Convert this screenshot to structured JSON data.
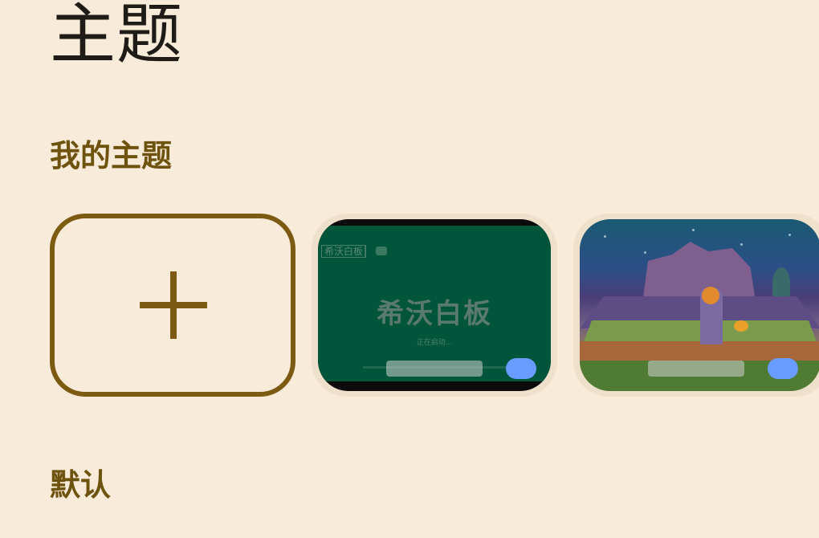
{
  "page": {
    "title": "主题"
  },
  "sections": {
    "my_themes": "我的主题",
    "default": "默认"
  },
  "add_tile": {
    "icon": "plus-icon"
  },
  "themes": [
    {
      "thumbnail": {
        "logo_text": "希沃白板",
        "title_text": "希沃白板",
        "loading_text": "正在启动..."
      },
      "toggle_on": true
    },
    {
      "thumbnail": {
        "scene": "game-scene"
      },
      "toggle_on": true
    }
  ],
  "colors": {
    "background": "#f9ebda",
    "title": "#1f1b16",
    "section_title": "#6e530f",
    "add_border": "#7d5a12",
    "tile_frame": "#efe0cb",
    "toggle": "#6a9cff",
    "board_green": "#00553a"
  }
}
